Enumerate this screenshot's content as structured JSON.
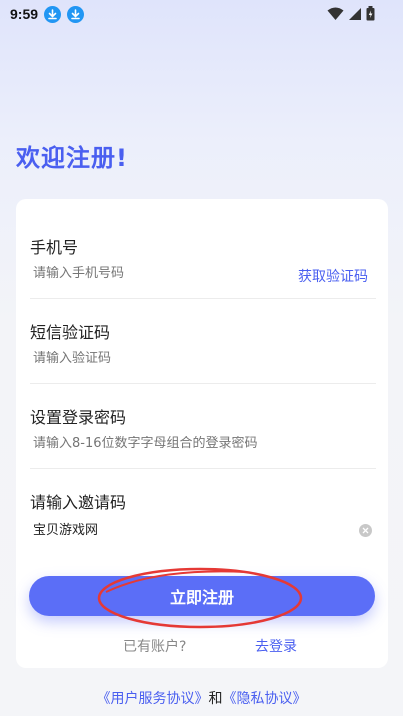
{
  "status": {
    "time": "9:59",
    "icons": [
      "download-icon",
      "download-icon",
      "wifi-icon",
      "signal-icon",
      "battery-icon"
    ]
  },
  "page": {
    "title": "欢迎注册!"
  },
  "form": {
    "phone": {
      "label": "手机号",
      "placeholder": "请输入手机号码",
      "code_link": "获取验证码"
    },
    "sms": {
      "label": "短信验证码",
      "placeholder": "请输入验证码"
    },
    "password": {
      "label": "设置登录密码",
      "placeholder": "请输入8-16位数字字母组合的登录密码"
    },
    "invite": {
      "label": "请输入邀请码",
      "value": "宝贝游戏网"
    }
  },
  "actions": {
    "register_label": "立即注册",
    "has_account": "已有账户?",
    "login_link": "去登录"
  },
  "footer": {
    "user_agreement": "《用户服务协议》",
    "and": "和",
    "privacy": "《隐私协议》"
  },
  "colors": {
    "accent": "#4a5ff0",
    "button": "#5b6ef7",
    "annotation": "#e53935"
  }
}
